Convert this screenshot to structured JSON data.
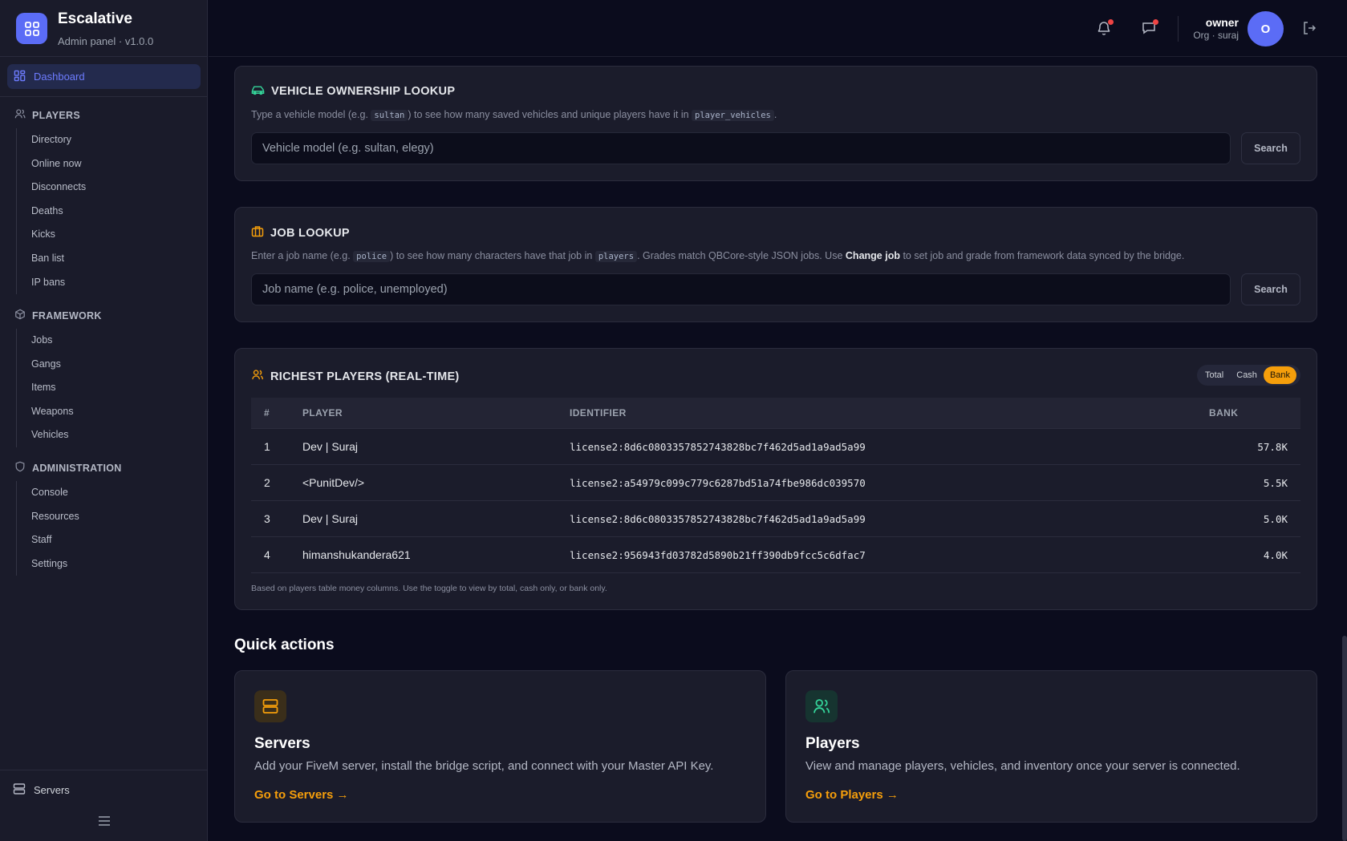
{
  "brand": {
    "name": "Escalative",
    "subtitle": "Admin panel · v1.0.0"
  },
  "nav": {
    "dashboard": "Dashboard",
    "sections": [
      {
        "title": "PLAYERS",
        "items": [
          "Directory",
          "Online now",
          "Disconnects",
          "Deaths",
          "Kicks",
          "Ban list",
          "IP bans"
        ]
      },
      {
        "title": "FRAMEWORK",
        "items": [
          "Jobs",
          "Gangs",
          "Items",
          "Weapons",
          "Vehicles"
        ]
      },
      {
        "title": "ADMINISTRATION",
        "items": [
          "Console",
          "Resources",
          "Staff",
          "Settings"
        ]
      }
    ],
    "footer": "Servers"
  },
  "user": {
    "name": "owner",
    "org": "Org · suraj",
    "initial": "O"
  },
  "vehicle_lookup": {
    "title": "VEHICLE OWNERSHIP LOOKUP",
    "desc_pre": "Type a vehicle model (e.g.",
    "desc_code1": "sultan",
    "desc_mid": ") to see how many saved vehicles and unique players have it in",
    "desc_code2": "player_vehicles",
    "desc_post": ".",
    "placeholder": "Vehicle model (e.g. sultan, elegy)",
    "button": "Search"
  },
  "job_lookup": {
    "title": "JOB LOOKUP",
    "desc_pre": "Enter a job name (e.g.",
    "desc_code1": "police",
    "desc_mid": ") to see how many characters have that job in",
    "desc_code2": "players",
    "desc_mid2": ". Grades match QBCore-style JSON jobs. Use",
    "desc_bold": "Change job",
    "desc_post": "to set job and grade from framework data synced by the bridge.",
    "placeholder": "Job name (e.g. police, unemployed)",
    "button": "Search"
  },
  "richest": {
    "title": "RICHEST PLAYERS (REAL-TIME)",
    "toggle": {
      "options": [
        "Total",
        "Cash",
        "Bank"
      ],
      "selected": "Bank"
    },
    "columns": {
      "rank": "#",
      "player": "PLAYER",
      "identifier": "IDENTIFIER",
      "value": "BANK"
    },
    "rows": [
      {
        "rank": "1",
        "player": "Dev | Suraj",
        "identifier": "license2:8d6c0803357852743828bc7f462d5ad1a9ad5a99",
        "value": "57.8K"
      },
      {
        "rank": "2",
        "player": "<PunitDev/>",
        "identifier": "license2:a54979c099c779c6287bd51a74fbe986dc039570",
        "value": "5.5K"
      },
      {
        "rank": "3",
        "player": "Dev | Suraj",
        "identifier": "license2:8d6c0803357852743828bc7f462d5ad1a9ad5a99",
        "value": "5.0K"
      },
      {
        "rank": "4",
        "player": "himanshukandera621",
        "identifier": "license2:956943fd03782d5890b21ff390db9fcc5c6dfac7",
        "value": "4.0K"
      }
    ],
    "footnote": "Based on players table money columns. Use the toggle to view by total, cash only, or bank only."
  },
  "quick_actions": {
    "title": "Quick actions",
    "cards": [
      {
        "name": "Servers",
        "desc": "Add your FiveM server, install the bridge script, and connect with your Master API Key.",
        "link": "Go to Servers →",
        "icon": "server-icon"
      },
      {
        "name": "Players",
        "desc": "View and manage players, vehicles, and inventory once your server is connected.",
        "link": "Go to Players →",
        "icon": "users-icon"
      }
    ]
  },
  "colors": {
    "accent": "#5b6cf6",
    "highlight": "#f59e0b",
    "background": "#0b0c1d",
    "panel": "#1b1c2b"
  }
}
